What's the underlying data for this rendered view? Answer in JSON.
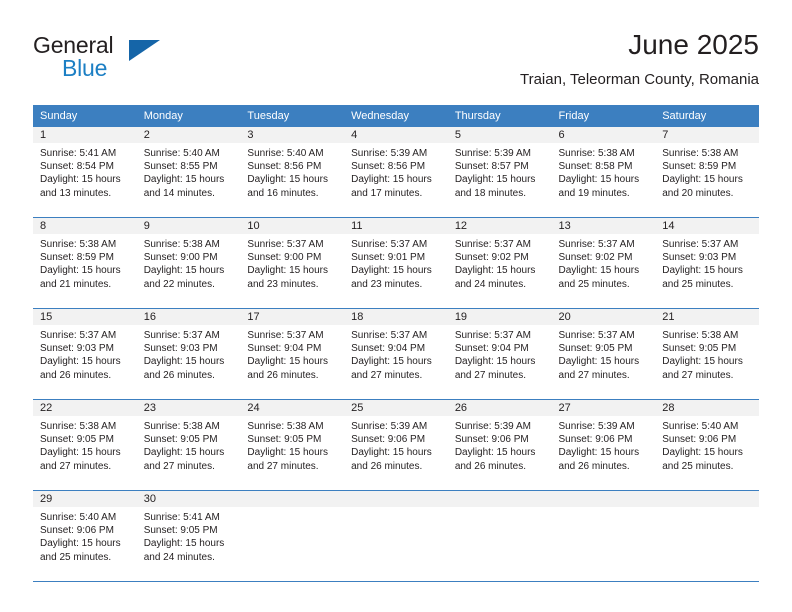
{
  "brand": {
    "name_part1": "General",
    "name_part2": "Blue",
    "triangle_color": "#1565a8",
    "blue_color": "#1c7fc4"
  },
  "header": {
    "month_title": "June 2025",
    "location": "Traian, Teleorman County, Romania"
  },
  "theme": {
    "header_bg": "#3c7fc0",
    "header_text": "#ffffff",
    "daynum_bg": "#f2f2f2",
    "body_text": "#231f20",
    "row_divider": "#3c7fc0"
  },
  "weekday_headers": [
    "Sunday",
    "Monday",
    "Tuesday",
    "Wednesday",
    "Thursday",
    "Friday",
    "Saturday"
  ],
  "weeks": [
    [
      {
        "day": "1",
        "sunrise": "Sunrise: 5:41 AM",
        "sunset": "Sunset: 8:54 PM",
        "daylight_line1": "Daylight: 15 hours",
        "daylight_line2": "and 13 minutes."
      },
      {
        "day": "2",
        "sunrise": "Sunrise: 5:40 AM",
        "sunset": "Sunset: 8:55 PM",
        "daylight_line1": "Daylight: 15 hours",
        "daylight_line2": "and 14 minutes."
      },
      {
        "day": "3",
        "sunrise": "Sunrise: 5:40 AM",
        "sunset": "Sunset: 8:56 PM",
        "daylight_line1": "Daylight: 15 hours",
        "daylight_line2": "and 16 minutes."
      },
      {
        "day": "4",
        "sunrise": "Sunrise: 5:39 AM",
        "sunset": "Sunset: 8:56 PM",
        "daylight_line1": "Daylight: 15 hours",
        "daylight_line2": "and 17 minutes."
      },
      {
        "day": "5",
        "sunrise": "Sunrise: 5:39 AM",
        "sunset": "Sunset: 8:57 PM",
        "daylight_line1": "Daylight: 15 hours",
        "daylight_line2": "and 18 minutes."
      },
      {
        "day": "6",
        "sunrise": "Sunrise: 5:38 AM",
        "sunset": "Sunset: 8:58 PM",
        "daylight_line1": "Daylight: 15 hours",
        "daylight_line2": "and 19 minutes."
      },
      {
        "day": "7",
        "sunrise": "Sunrise: 5:38 AM",
        "sunset": "Sunset: 8:59 PM",
        "daylight_line1": "Daylight: 15 hours",
        "daylight_line2": "and 20 minutes."
      }
    ],
    [
      {
        "day": "8",
        "sunrise": "Sunrise: 5:38 AM",
        "sunset": "Sunset: 8:59 PM",
        "daylight_line1": "Daylight: 15 hours",
        "daylight_line2": "and 21 minutes."
      },
      {
        "day": "9",
        "sunrise": "Sunrise: 5:38 AM",
        "sunset": "Sunset: 9:00 PM",
        "daylight_line1": "Daylight: 15 hours",
        "daylight_line2": "and 22 minutes."
      },
      {
        "day": "10",
        "sunrise": "Sunrise: 5:37 AM",
        "sunset": "Sunset: 9:00 PM",
        "daylight_line1": "Daylight: 15 hours",
        "daylight_line2": "and 23 minutes."
      },
      {
        "day": "11",
        "sunrise": "Sunrise: 5:37 AM",
        "sunset": "Sunset: 9:01 PM",
        "daylight_line1": "Daylight: 15 hours",
        "daylight_line2": "and 23 minutes."
      },
      {
        "day": "12",
        "sunrise": "Sunrise: 5:37 AM",
        "sunset": "Sunset: 9:02 PM",
        "daylight_line1": "Daylight: 15 hours",
        "daylight_line2": "and 24 minutes."
      },
      {
        "day": "13",
        "sunrise": "Sunrise: 5:37 AM",
        "sunset": "Sunset: 9:02 PM",
        "daylight_line1": "Daylight: 15 hours",
        "daylight_line2": "and 25 minutes."
      },
      {
        "day": "14",
        "sunrise": "Sunrise: 5:37 AM",
        "sunset": "Sunset: 9:03 PM",
        "daylight_line1": "Daylight: 15 hours",
        "daylight_line2": "and 25 minutes."
      }
    ],
    [
      {
        "day": "15",
        "sunrise": "Sunrise: 5:37 AM",
        "sunset": "Sunset: 9:03 PM",
        "daylight_line1": "Daylight: 15 hours",
        "daylight_line2": "and 26 minutes."
      },
      {
        "day": "16",
        "sunrise": "Sunrise: 5:37 AM",
        "sunset": "Sunset: 9:03 PM",
        "daylight_line1": "Daylight: 15 hours",
        "daylight_line2": "and 26 minutes."
      },
      {
        "day": "17",
        "sunrise": "Sunrise: 5:37 AM",
        "sunset": "Sunset: 9:04 PM",
        "daylight_line1": "Daylight: 15 hours",
        "daylight_line2": "and 26 minutes."
      },
      {
        "day": "18",
        "sunrise": "Sunrise: 5:37 AM",
        "sunset": "Sunset: 9:04 PM",
        "daylight_line1": "Daylight: 15 hours",
        "daylight_line2": "and 27 minutes."
      },
      {
        "day": "19",
        "sunrise": "Sunrise: 5:37 AM",
        "sunset": "Sunset: 9:04 PM",
        "daylight_line1": "Daylight: 15 hours",
        "daylight_line2": "and 27 minutes."
      },
      {
        "day": "20",
        "sunrise": "Sunrise: 5:37 AM",
        "sunset": "Sunset: 9:05 PM",
        "daylight_line1": "Daylight: 15 hours",
        "daylight_line2": "and 27 minutes."
      },
      {
        "day": "21",
        "sunrise": "Sunrise: 5:38 AM",
        "sunset": "Sunset: 9:05 PM",
        "daylight_line1": "Daylight: 15 hours",
        "daylight_line2": "and 27 minutes."
      }
    ],
    [
      {
        "day": "22",
        "sunrise": "Sunrise: 5:38 AM",
        "sunset": "Sunset: 9:05 PM",
        "daylight_line1": "Daylight: 15 hours",
        "daylight_line2": "and 27 minutes."
      },
      {
        "day": "23",
        "sunrise": "Sunrise: 5:38 AM",
        "sunset": "Sunset: 9:05 PM",
        "daylight_line1": "Daylight: 15 hours",
        "daylight_line2": "and 27 minutes."
      },
      {
        "day": "24",
        "sunrise": "Sunrise: 5:38 AM",
        "sunset": "Sunset: 9:05 PM",
        "daylight_line1": "Daylight: 15 hours",
        "daylight_line2": "and 27 minutes."
      },
      {
        "day": "25",
        "sunrise": "Sunrise: 5:39 AM",
        "sunset": "Sunset: 9:06 PM",
        "daylight_line1": "Daylight: 15 hours",
        "daylight_line2": "and 26 minutes."
      },
      {
        "day": "26",
        "sunrise": "Sunrise: 5:39 AM",
        "sunset": "Sunset: 9:06 PM",
        "daylight_line1": "Daylight: 15 hours",
        "daylight_line2": "and 26 minutes."
      },
      {
        "day": "27",
        "sunrise": "Sunrise: 5:39 AM",
        "sunset": "Sunset: 9:06 PM",
        "daylight_line1": "Daylight: 15 hours",
        "daylight_line2": "and 26 minutes."
      },
      {
        "day": "28",
        "sunrise": "Sunrise: 5:40 AM",
        "sunset": "Sunset: 9:06 PM",
        "daylight_line1": "Daylight: 15 hours",
        "daylight_line2": "and 25 minutes."
      }
    ],
    [
      {
        "day": "29",
        "sunrise": "Sunrise: 5:40 AM",
        "sunset": "Sunset: 9:06 PM",
        "daylight_line1": "Daylight: 15 hours",
        "daylight_line2": "and 25 minutes."
      },
      {
        "day": "30",
        "sunrise": "Sunrise: 5:41 AM",
        "sunset": "Sunset: 9:05 PM",
        "daylight_line1": "Daylight: 15 hours",
        "daylight_line2": "and 24 minutes."
      },
      {
        "day": "",
        "sunrise": "",
        "sunset": "",
        "daylight_line1": "",
        "daylight_line2": ""
      },
      {
        "day": "",
        "sunrise": "",
        "sunset": "",
        "daylight_line1": "",
        "daylight_line2": ""
      },
      {
        "day": "",
        "sunrise": "",
        "sunset": "",
        "daylight_line1": "",
        "daylight_line2": ""
      },
      {
        "day": "",
        "sunrise": "",
        "sunset": "",
        "daylight_line1": "",
        "daylight_line2": ""
      },
      {
        "day": "",
        "sunrise": "",
        "sunset": "",
        "daylight_line1": "",
        "daylight_line2": ""
      }
    ]
  ]
}
